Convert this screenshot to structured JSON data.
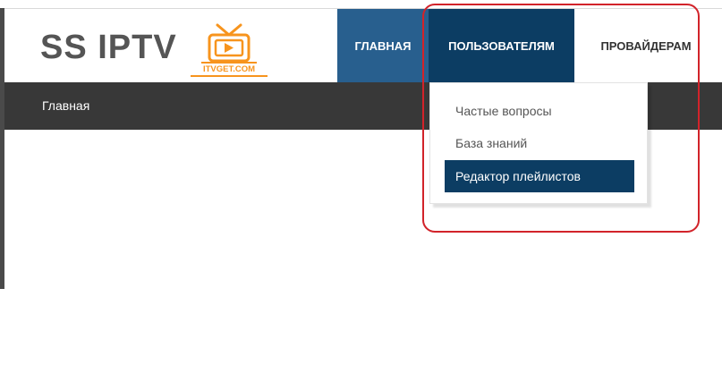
{
  "site": {
    "title": "SS IPTV",
    "logo_text": "ITVGET.COM"
  },
  "nav": {
    "items": [
      {
        "label": "ГЛАВНАЯ"
      },
      {
        "label": "ПОЛЬЗОВАТЕЛЯМ"
      },
      {
        "label": "ПРОВАЙДЕРАМ"
      }
    ]
  },
  "breadcrumb": {
    "current": "Главная"
  },
  "dropdown": {
    "items": [
      {
        "label": "Частые вопросы"
      },
      {
        "label": "База знаний"
      },
      {
        "label": "Редактор плейлистов",
        "active": true
      }
    ]
  },
  "colors": {
    "nav_home": "#285f8e",
    "nav_active": "#0c3d63",
    "subbar": "#383838",
    "logo_orange": "#f7941d",
    "annotation": "#d2232a"
  },
  "icons": [
    "tv-logo-icon"
  ]
}
